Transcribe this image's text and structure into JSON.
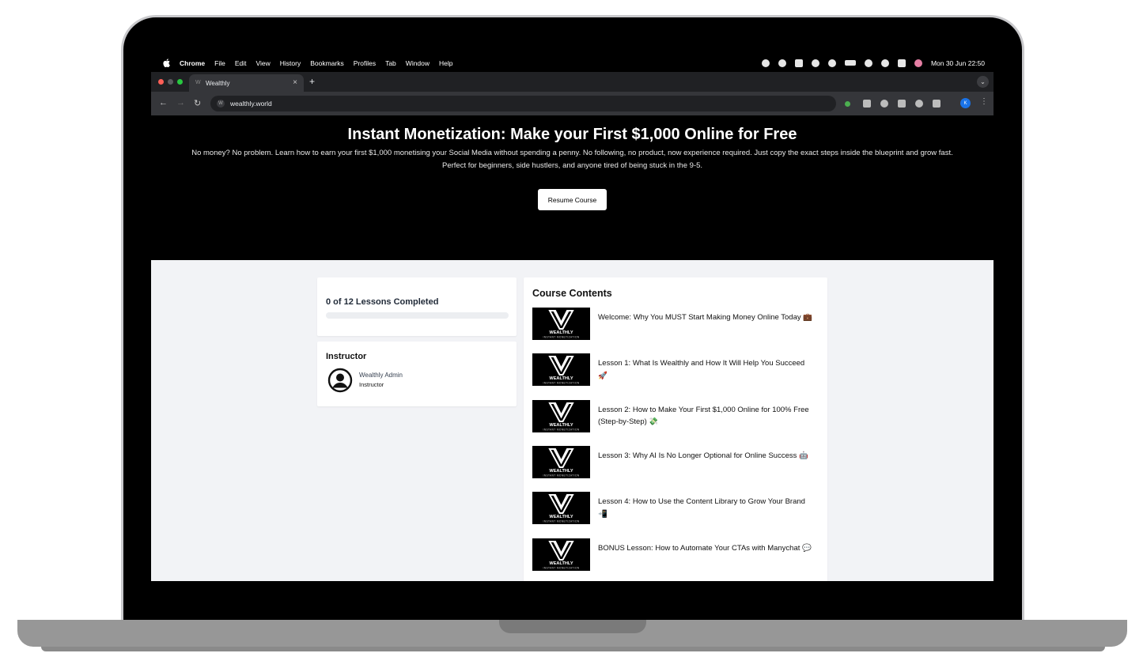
{
  "menubar": {
    "app": "Chrome",
    "items": [
      "File",
      "Edit",
      "View",
      "History",
      "Bookmarks",
      "Profiles",
      "Tab",
      "Window",
      "Help"
    ],
    "clock": "Mon 30 Jun  22:50"
  },
  "browser": {
    "tab_title": "Wealthly",
    "tab_close": "×",
    "new_tab": "+",
    "url": "wealthly.world",
    "profile_initial": "K"
  },
  "hero": {
    "title": "Instant Monetization: Make your First $1,000 Online for Free",
    "description": "No money? No problem. Learn how to earn your first $1,000 monetising your Social Media without spending a penny. No following, no product, now experience required. Just copy the exact steps inside the blueprint and grow fast. Perfect for beginners, side hustlers, and anyone tired of being stuck in the 9-5.",
    "button": "Resume Course"
  },
  "progress": {
    "label": "0 of 12 Lessons Completed",
    "fraction": 0
  },
  "instructor": {
    "heading": "Instructor",
    "name": "Wealthly Admin",
    "role": "Instructor"
  },
  "contents": {
    "heading": "Course Contents",
    "thumb_brand": "WEALTHLY",
    "thumb_sub": "INSTANT MONETIZATION",
    "lessons": [
      {
        "title": "Welcome: Why You MUST Start Making Money Online Today 💼"
      },
      {
        "title": "Lesson 1: What Is Wealthly and How It Will Help You Succeed 🚀"
      },
      {
        "title": "Lesson 2: How to Make Your First $1,000 Online for 100% Free (Step-by-Step) 💸"
      },
      {
        "title": "Lesson 3: Why AI Is No Longer Optional for Online Success 🤖"
      },
      {
        "title": "Lesson 4: How to Use the Content Library to Grow Your Brand 📲"
      },
      {
        "title": "BONUS Lesson: How to Automate Your CTAs with Manychat 💬"
      }
    ]
  },
  "colors": {
    "hero_bg": "#000000",
    "page_bg": "#f2f3f6",
    "chrome_dark": "#202124"
  }
}
